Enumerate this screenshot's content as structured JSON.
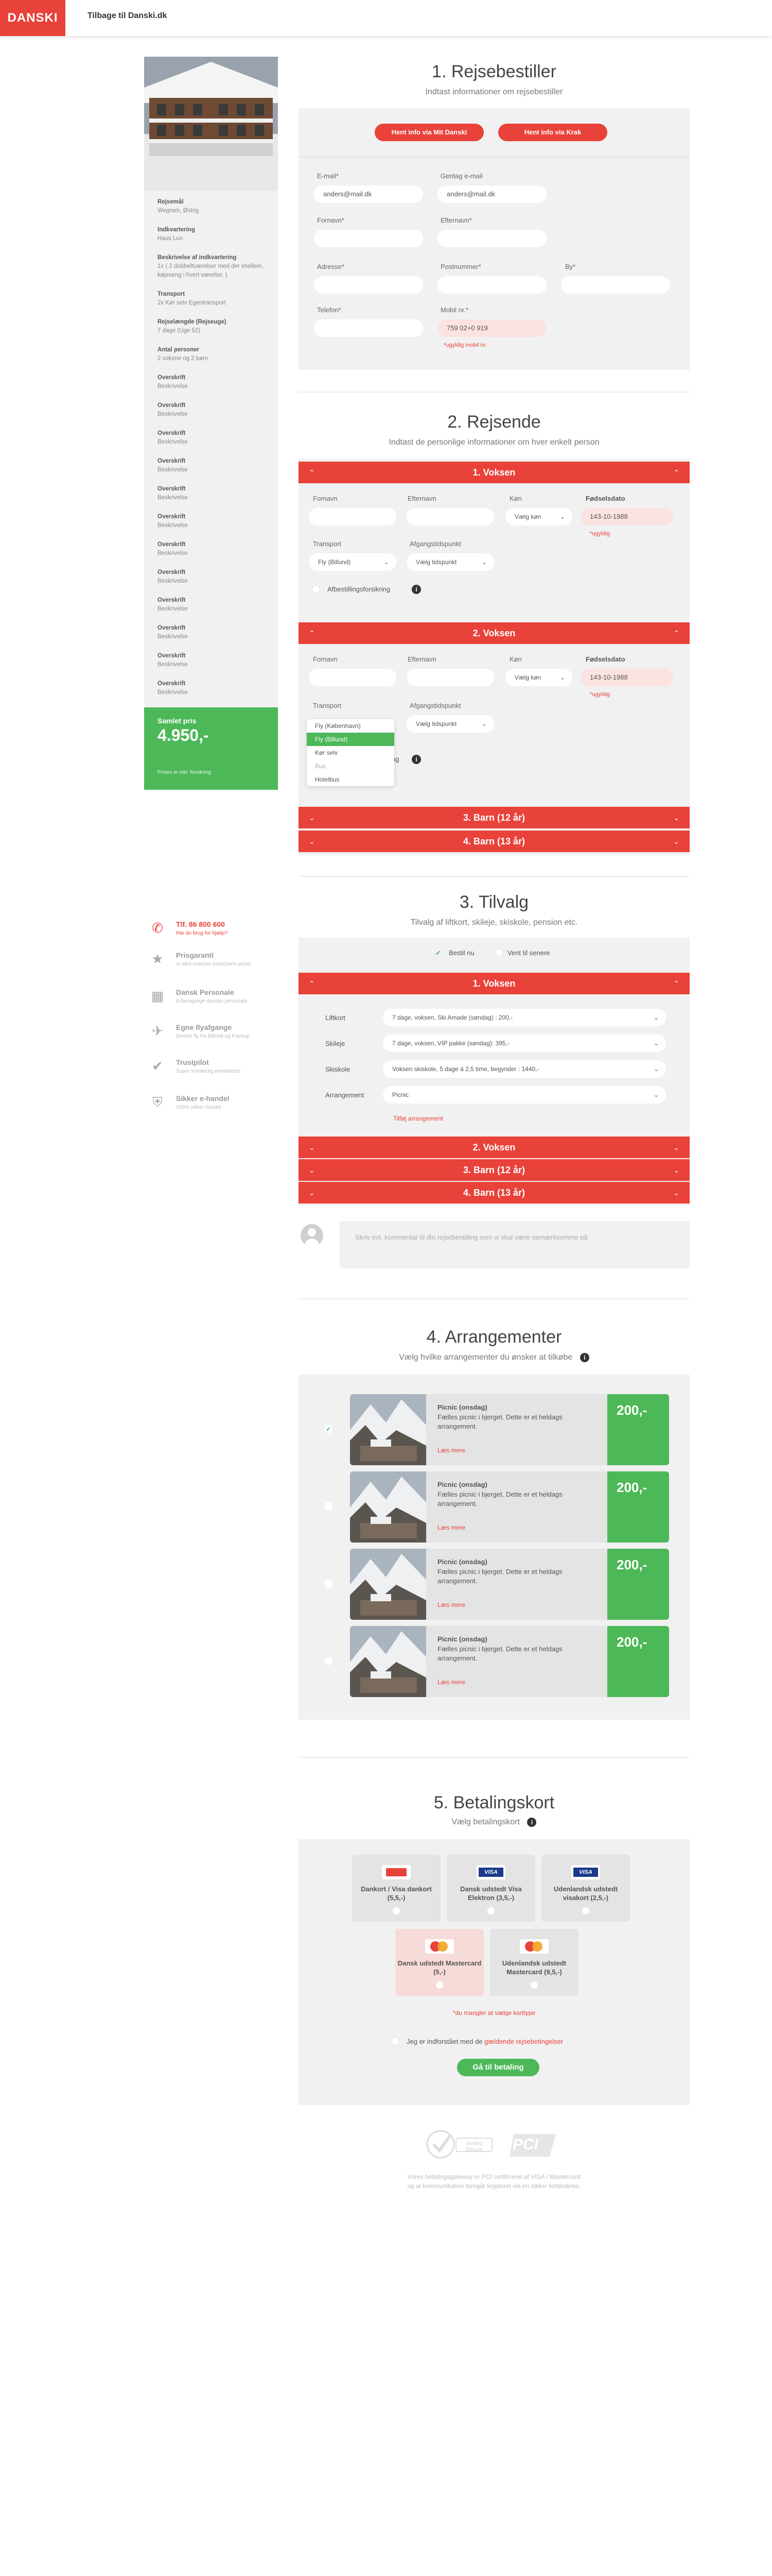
{
  "header": {
    "logo": "DANSKI",
    "back_link": "Tilbage til Danski.dk"
  },
  "sidebar": {
    "info": [
      {
        "label": "Rejsemål",
        "value": "Wegram, Østrig"
      },
      {
        "label": "Indkvartering",
        "value": "Haus Lun"
      },
      {
        "label": "Beskrivelse af indkvartering",
        "value": "1x ( 2 dobbeltværelser med der imellem, køjeseng i hvert værelse. )"
      },
      {
        "label": "Transport",
        "value": "2x Kør selv Egentransport"
      },
      {
        "label": "Rejselængde (Rejseuge)",
        "value": "7 dage (Uge 52)"
      },
      {
        "label": "Antal personer",
        "value": "2 voksne og 2 børn"
      },
      {
        "label": "Overskrift",
        "value": "Beskrivelse"
      },
      {
        "label": "Overskrift",
        "value": "Beskrivelse"
      },
      {
        "label": "Overskrift",
        "value": "Beskrivelse"
      },
      {
        "label": "Overskrift",
        "value": "Beskrivelse"
      },
      {
        "label": "Overskrift",
        "value": "Beskrivelse"
      },
      {
        "label": "Overskrift",
        "value": "Beskrivelse"
      },
      {
        "label": "Overskrift",
        "value": "Beskrivelse"
      },
      {
        "label": "Overskrift",
        "value": "Beskrivelse"
      },
      {
        "label": "Overskrift",
        "value": "Beskrivelse"
      },
      {
        "label": "Overskrift",
        "value": "Beskrivelse"
      },
      {
        "label": "Overskrift",
        "value": "Beskrivelse"
      },
      {
        "label": "Overskrift",
        "value": "Beskrivelse"
      }
    ],
    "price_label": "Samlet pris",
    "price": "4.950,-",
    "price_note": "Prisen er inkl. forsikring"
  },
  "features": [
    {
      "icon": "phone-icon",
      "title": "Tlf. 86 800 600",
      "sub": "Har du brug for hjælp?"
    },
    {
      "icon": "star-icon",
      "title": "Prisgaranti",
      "sub": "Vi altid matcher branchens priser"
    },
    {
      "icon": "grid-icon",
      "title": "Dansk Personale",
      "sub": "Erfaringsrige danske personale"
    },
    {
      "icon": "plane-icon",
      "title": "Egne flyafgange",
      "sub": "Direkte fly fra Billund og Kastrup"
    },
    {
      "icon": "check-icon",
      "title": "Trustpilot",
      "sub": "Super troværdig anmeldelse"
    },
    {
      "icon": "shield-icon",
      "title": "Sikker e-handel",
      "sub": "100% sikker handel"
    }
  ],
  "s1": {
    "title": "1. Rejsebestiller",
    "sub": "Indtast informationer om rejsebestiller",
    "btn_mit": "Hent info via Mit Danski",
    "btn_krak": "Hent info via Krak",
    "email_label": "E-mail*",
    "email_value": "anders@mail.dk",
    "email2_label": "Gentag e-mail",
    "email2_value": "anders@mail.dk",
    "fornavn_label": "Fornavn*",
    "efternavn_label": "Efternavn*",
    "adresse_label": "Adresse*",
    "postnr_label": "Postnummer*",
    "by_label": "By*",
    "telefon_label": "Telefon*",
    "mobil_label": "Mobil nr.*",
    "mobil_value": "759 02+0 919",
    "mobil_err": "*ugyldig mobil nr."
  },
  "s2": {
    "title": "2. Rejsende",
    "sub": "Indtast de personlige informationer om hver enkelt person",
    "bars": [
      "1. Voksen",
      "2. Voksen",
      "3. Barn (12 år)",
      "4. Barn (13 år)"
    ],
    "fornavn": "Fornavn",
    "efternavn": "Efternavn",
    "koen": "Køn",
    "koen_value": "Vælg køn",
    "dob": "Fødselsdato",
    "dob_value": "143-10-1988",
    "dob_err": "*ugyldig",
    "transport": "Transport",
    "transport_value": "Fly (Billund)",
    "afgang": "Afgangstidspunkt",
    "afgang_value": "Vælg tidspunkt",
    "forsikring": "Afbestillingsforsikring",
    "dd_options": [
      "Fly (København)",
      "Fly (Billund)",
      "Kør selv",
      "Bus",
      "Hotelbus"
    ],
    "dd_short": "ing"
  },
  "s3": {
    "title": "3. Tilvalg",
    "sub": "Tilvalg af liftkort, skileje, skiskole, pension etc.",
    "opt_now": "Bestil nu",
    "opt_later": "Vent til senere",
    "bars": [
      "1. Voksen",
      "2. Voksen",
      "3. Barn (12 år)",
      "4. Barn (13 år)"
    ],
    "rows": [
      {
        "label": "Liftkort",
        "value": "7 dage, voksen, Ski Amade (søndag) : 200,-"
      },
      {
        "label": "Skileje",
        "value": "7 dage, voksen, VIP pakke (søndag): 395,-"
      },
      {
        "label": "Skiskole",
        "value": "Voksen skiskole, 5 dage á 2,5 time, begynder : 1440,-"
      },
      {
        "label": "Arrangement",
        "value": "Picnic"
      }
    ],
    "add": "Tilføj arrangement",
    "comment": "Skriv evt. kommentar til din rejsebestilling som vi skal være opmærksomme på"
  },
  "s4": {
    "title": "4. Arrangementer",
    "sub": "Vælg hvilke arrangementer du ønsker at tilkøbe",
    "cards": [
      {
        "title": "Picnic (onsdag)",
        "desc": "Fælles picnic i bjerget. Dette er et heldags arrangement.",
        "link": "Læs mere",
        "price": "200,-",
        "selected": true
      },
      {
        "title": "Picnic (onsdag)",
        "desc": "Fælles picnic i bjerget. Dette er et heldags arrangement.",
        "link": "Læs mere",
        "price": "200,-",
        "selected": false
      },
      {
        "title": "Picnic (onsdag)",
        "desc": "Fælles picnic i bjerget. Dette er et heldags arrangement.",
        "link": "Læs mere",
        "price": "200,-",
        "selected": false
      },
      {
        "title": "Picnic (onsdag)",
        "desc": "Fælles picnic i bjerget. Dette er et heldags arrangement.",
        "link": "Læs mere",
        "price": "200,-",
        "selected": false
      }
    ]
  },
  "s5": {
    "title": "5. Betalingskort",
    "sub": "Vælg betalingskort",
    "cards": [
      {
        "logo": "Dankort",
        "name": "Dankort / Visa dankort (5,5,-)"
      },
      {
        "logo": "VISA",
        "name": "Dansk udstedt Visa Elektron (3,5,-)"
      },
      {
        "logo": "VISA",
        "name": "Udenlandsk udstedt visakort (2,5,-)"
      },
      {
        "logo": "MC",
        "name": "Dansk udstedt Mastercard (5,-)"
      },
      {
        "logo": "MC",
        "name": "Udenlandsk udstedt Mastercard (9,5,-)"
      }
    ],
    "err": "*du mangler at vælge korttype",
    "terms_pre": "Jeg er indforstået med de ",
    "terms_link": "gældende rejsebetingelser",
    "submit": "Gå til betaling",
    "badge1": "Verified Secure",
    "badge2": "PCI",
    "footer1": "Vores betalingsgateway er PCI certificeret af VISA / Mastercard",
    "footer2": "og al kommunikation foregår krypteret via en sikker forbindelse."
  }
}
